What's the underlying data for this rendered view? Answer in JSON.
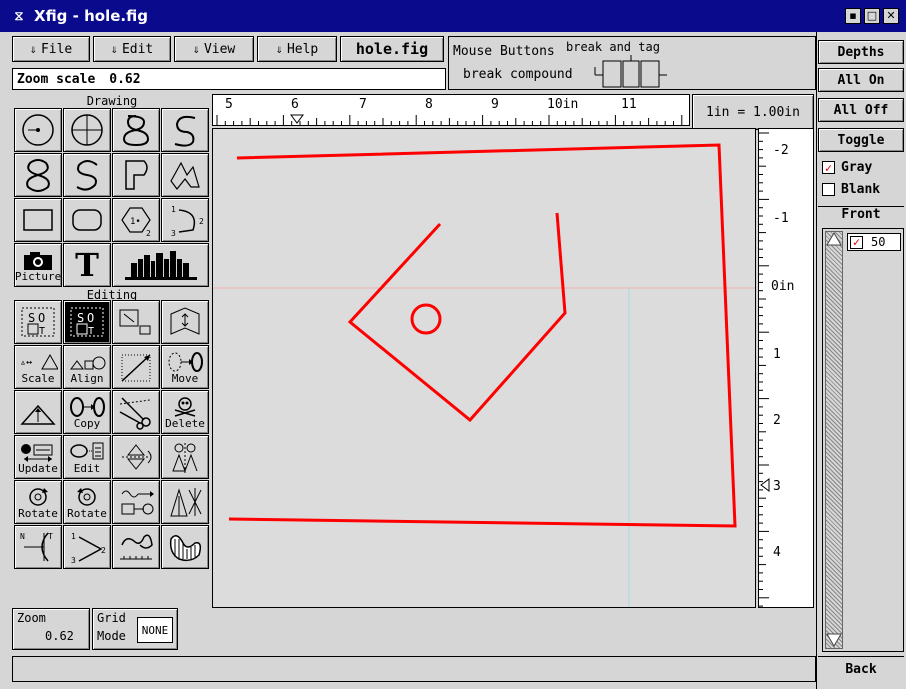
{
  "window": {
    "title": "Xfig - hole.fig",
    "icon_glyph": "⧖",
    "min_glyph": "▪",
    "max_glyph": "□",
    "close_glyph": "✕"
  },
  "menu": {
    "items": [
      {
        "label": "File",
        "icon": "down-arrow-icon"
      },
      {
        "label": "Edit",
        "icon": "down-arrow-icon"
      },
      {
        "label": "View",
        "icon": "down-arrow-icon"
      },
      {
        "label": "Help",
        "icon": "down-arrow-icon"
      }
    ],
    "arrow_glyph": "⇓",
    "filename": "hole.fig"
  },
  "mouse": {
    "label": "Mouse Buttons",
    "left": "break compound",
    "right": "break and tag"
  },
  "zoom_field": {
    "label": "Zoom scale",
    "value": "0.62"
  },
  "sections": {
    "drawing": "Drawing",
    "editing": "Editing"
  },
  "tool_labels": {
    "picture": "Picture",
    "text_glyph": "T",
    "scale": "Scale",
    "align": "Align",
    "move": "Move",
    "copy": "Copy",
    "delete": "Delete",
    "update": "Update",
    "edit": "Edit",
    "rotate_cw": "Rotate",
    "rotate_ccw": "Rotate"
  },
  "ruler": {
    "top_ticks": [
      "5",
      "6",
      "7",
      "8",
      "9",
      "10in",
      "11"
    ],
    "right_ticks": [
      "-2",
      "-1",
      "0in",
      "1",
      "2",
      "3",
      "4"
    ],
    "scale_label": "1in = 1.00in"
  },
  "bottom": {
    "zoom_label": "Zoom",
    "zoom_value": "0.62",
    "grid_label": "Grid",
    "mode_label": "Mode",
    "grid_value": "NONE"
  },
  "depth_panel": {
    "depths": "Depths",
    "all_on": "All On",
    "all_off": "All Off",
    "toggle": "Toggle",
    "gray": "Gray",
    "blank": "Blank",
    "front": "Front",
    "back": "Back",
    "layer_value": "50",
    "check_glyph": "✓"
  },
  "colors": {
    "drawing": "#ff0000",
    "title_bg": "#0a0a8c",
    "canvas": "#dcdcdc",
    "guide_v": "#a8d8e8",
    "guide_h": "#f0b0b0"
  }
}
